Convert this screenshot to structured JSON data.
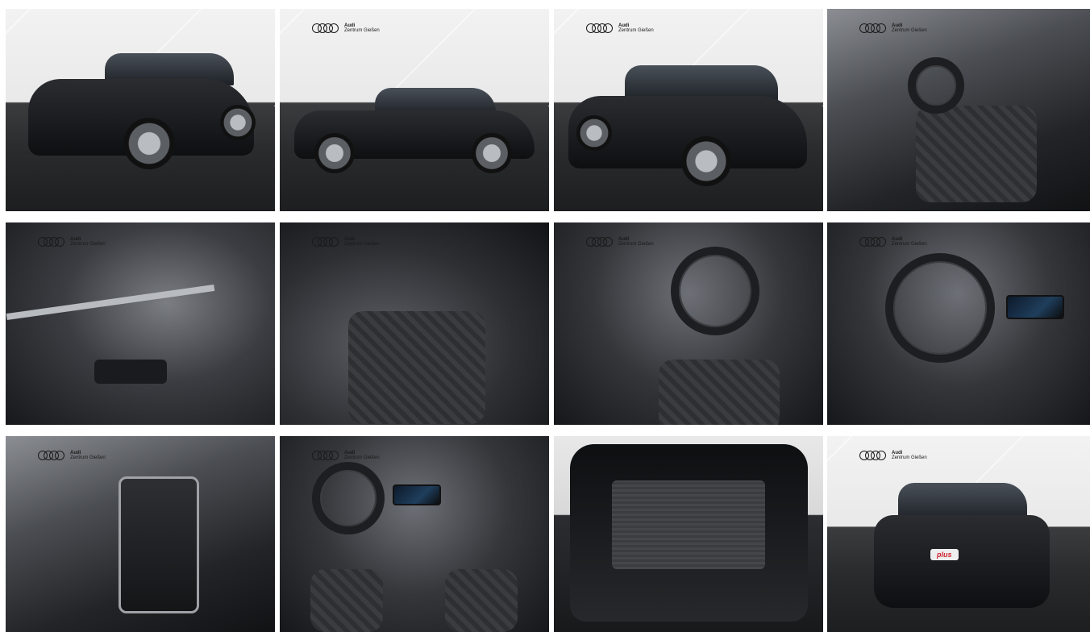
{
  "gallery": {
    "logo": {
      "brand": "Audi",
      "dealer": "Zentrum Gießen"
    },
    "images": [
      {
        "subject": "exterior-front-quarter"
      },
      {
        "subject": "exterior-side"
      },
      {
        "subject": "exterior-rear-quarter"
      },
      {
        "subject": "interior-front-seats"
      },
      {
        "subject": "door-panel"
      },
      {
        "subject": "rear-seats"
      },
      {
        "subject": "cockpit-left"
      },
      {
        "subject": "cockpit-steering-wheel"
      },
      {
        "subject": "center-console"
      },
      {
        "subject": "dashboard-overview"
      },
      {
        "subject": "open-trunk"
      },
      {
        "subject": "exterior-rear"
      }
    ],
    "plate_badge": "plus"
  }
}
